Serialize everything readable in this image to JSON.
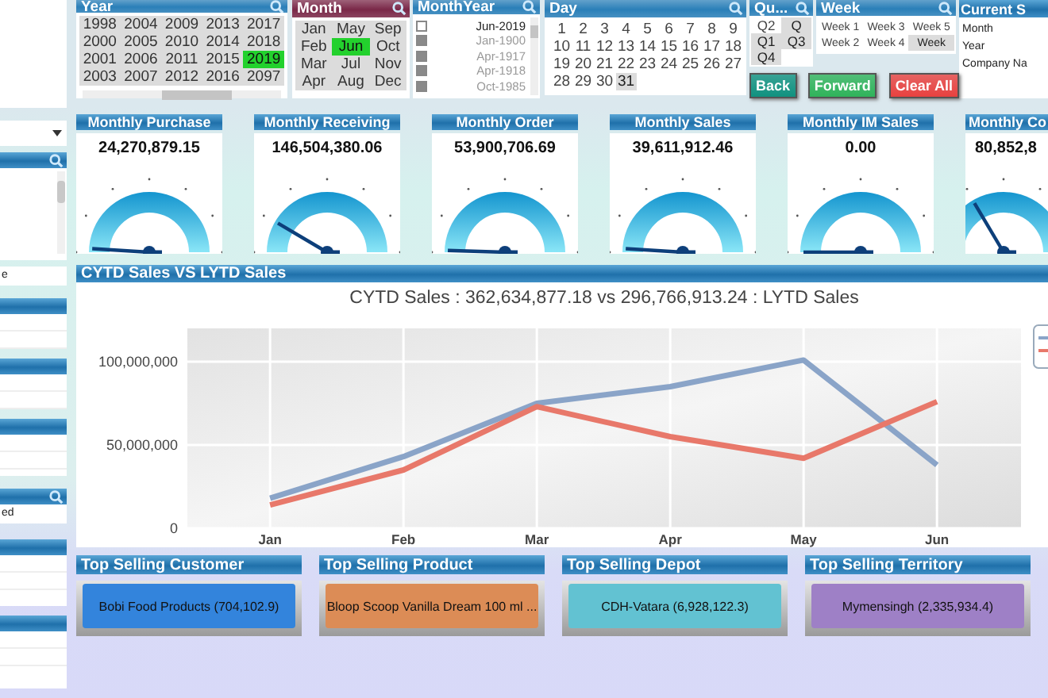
{
  "sidebar": [
    {
      "kind": "dropdown"
    },
    {
      "kind": "listbox",
      "search": true
    },
    {
      "kind": "text",
      "text": "e"
    },
    {
      "kind": "listbox",
      "search": false
    },
    {
      "kind": "listbox",
      "search": false
    },
    {
      "kind": "listbox",
      "search": false
    },
    {
      "kind": "listbox",
      "search": true,
      "text": "ed"
    },
    {
      "kind": "listbox",
      "search": false
    },
    {
      "kind": "listbox",
      "search": false
    }
  ],
  "filters": {
    "year": {
      "title": "Year",
      "color": "#2a7fb8",
      "items": [
        {
          "label": "1998",
          "selected": false
        },
        {
          "label": "2000",
          "selected": false
        },
        {
          "label": "2001",
          "selected": false
        },
        {
          "label": "2003",
          "selected": false
        },
        {
          "label": "2004",
          "selected": false
        },
        {
          "label": "2005",
          "selected": false
        },
        {
          "label": "2006",
          "selected": false
        },
        {
          "label": "2007",
          "selected": false
        },
        {
          "label": "2009",
          "selected": false
        },
        {
          "label": "2010",
          "selected": false
        },
        {
          "label": "2011",
          "selected": false
        },
        {
          "label": "2012",
          "selected": false
        },
        {
          "label": "2013",
          "selected": false
        },
        {
          "label": "2014",
          "selected": false
        },
        {
          "label": "2015",
          "selected": false
        },
        {
          "label": "2016",
          "selected": false
        },
        {
          "label": "2017",
          "selected": false
        },
        {
          "label": "2018",
          "selected": false
        },
        {
          "label": "2019",
          "selected": true
        },
        {
          "label": "2097",
          "selected": false
        }
      ]
    },
    "month": {
      "title": "Month",
      "color": "#7a2848",
      "items": [
        {
          "label": "Jan",
          "selected": false
        },
        {
          "label": "Feb",
          "selected": false
        },
        {
          "label": "Mar",
          "selected": false
        },
        {
          "label": "Apr",
          "selected": false
        },
        {
          "label": "May",
          "selected": false
        },
        {
          "label": "Jun",
          "selected": true
        },
        {
          "label": "Jul",
          "selected": false
        },
        {
          "label": "Aug",
          "selected": false
        },
        {
          "label": "Sep",
          "selected": false
        },
        {
          "label": "Oct",
          "selected": false
        },
        {
          "label": "Nov",
          "selected": false
        },
        {
          "label": "Dec",
          "selected": false
        }
      ]
    },
    "month_year": {
      "title": "MonthYear",
      "color": "#2a7fb8",
      "items": [
        {
          "label": "Jun-2019",
          "excluded": false
        },
        {
          "label": "Jan-1900",
          "excluded": true
        },
        {
          "label": "Apr-1917",
          "excluded": true
        },
        {
          "label": "Apr-1918",
          "excluded": true
        },
        {
          "label": "Oct-1985",
          "excluded": true
        }
      ]
    },
    "day": {
      "title": "Day",
      "color": "#2a7fb8",
      "items": [
        {
          "label": "1",
          "excluded": false
        },
        {
          "label": "2",
          "excluded": false
        },
        {
          "label": "3",
          "excluded": false
        },
        {
          "label": "4",
          "excluded": false
        },
        {
          "label": "5",
          "excluded": false
        },
        {
          "label": "6",
          "excluded": false
        },
        {
          "label": "7",
          "excluded": false
        },
        {
          "label": "8",
          "excluded": false
        },
        {
          "label": "9",
          "excluded": false
        },
        {
          "label": "10",
          "excluded": false
        },
        {
          "label": "11",
          "excluded": false
        },
        {
          "label": "12",
          "excluded": false
        },
        {
          "label": "13",
          "excluded": false
        },
        {
          "label": "14",
          "excluded": false
        },
        {
          "label": "15",
          "excluded": false
        },
        {
          "label": "16",
          "excluded": false
        },
        {
          "label": "17",
          "excluded": false
        },
        {
          "label": "18",
          "excluded": false
        },
        {
          "label": "19",
          "excluded": false
        },
        {
          "label": "20",
          "excluded": false
        },
        {
          "label": "21",
          "excluded": false
        },
        {
          "label": "22",
          "excluded": false
        },
        {
          "label": "23",
          "excluded": false
        },
        {
          "label": "24",
          "excluded": false
        },
        {
          "label": "25",
          "excluded": false
        },
        {
          "label": "26",
          "excluded": false
        },
        {
          "label": "27",
          "excluded": false
        },
        {
          "label": "28",
          "excluded": false
        },
        {
          "label": "29",
          "excluded": false
        },
        {
          "label": "30",
          "excluded": false
        },
        {
          "label": "31",
          "excluded": true
        }
      ]
    },
    "quarter": {
      "title": "Qu...",
      "color": "#2a7fb8",
      "items": [
        {
          "label": "Q2",
          "excluded": false
        },
        {
          "label": "Q",
          "excluded": true
        },
        {
          "label": "Q1",
          "excluded": true
        },
        {
          "label": "Q3",
          "excluded": true
        },
        {
          "label": "Q4",
          "excluded": true
        }
      ]
    },
    "week": {
      "title": "Week",
      "color": "#2a7fb8",
      "items": [
        {
          "label": "Week 1",
          "excluded": false
        },
        {
          "label": "Week 3",
          "excluded": false
        },
        {
          "label": "Week 5",
          "excluded": false
        },
        {
          "label": "Week 2",
          "excluded": false
        },
        {
          "label": "Week 4",
          "excluded": false
        },
        {
          "label": "Week",
          "excluded": true
        }
      ]
    },
    "buttons": [
      {
        "label": "Back",
        "kind": "back"
      },
      {
        "label": "Forward",
        "kind": "forward"
      },
      {
        "label": "Clear All",
        "kind": "clear"
      }
    ],
    "current_selections": {
      "title": "Current S",
      "rows": [
        "Month",
        "Year",
        "Company Na"
      ]
    }
  },
  "gauges": [
    {
      "title": "Monthly Purchase",
      "value": "24,270,879.15"
    },
    {
      "title": "Monthly Receiving",
      "value": "146,504,380.06"
    },
    {
      "title": "Monthly Order",
      "value": "53,900,706.69"
    },
    {
      "title": "Monthly Sales",
      "value": "39,611,912.46"
    },
    {
      "title": "Monthly IM Sales",
      "value": "0.00"
    },
    {
      "title": "Monthly Co",
      "value": "80,852,8"
    }
  ],
  "sales_chart": {
    "caption": "CYTD Sales VS LYTD Sales",
    "chart_data": {
      "type": "line",
      "grid": true,
      "title": "CYTD Sales : 362,634,877.18 vs 296,766,913.24 : LYTD Sales",
      "categories": [
        "Jan",
        "Feb",
        "Mar",
        "Apr",
        "May",
        "Jun"
      ],
      "ylim": [
        0,
        120000000
      ],
      "yticks": [
        {
          "value": 0,
          "label": "0"
        },
        {
          "value": 50000000,
          "label": "50,000,000"
        },
        {
          "value": 100000000,
          "label": "100,000,000"
        }
      ],
      "series": [
        {
          "color": "#8aa4c8",
          "values": [
            18000000,
            43000000,
            75000000,
            85000000,
            101000000,
            38000000
          ]
        },
        {
          "color": "#e8786a",
          "values": [
            14000000,
            35000000,
            73000000,
            55000000,
            42000000,
            76000000
          ]
        }
      ]
    }
  },
  "top_selling": [
    {
      "title": "Top Selling Customer",
      "value": "Bobi Food Products (704,102.9)",
      "color": "#3384dc"
    },
    {
      "title": "Top Selling Product",
      "value": "Bloop Scoop Vanilla Dream 100 ml ...",
      "color": "#dc8c56"
    },
    {
      "title": "Top Selling Depot",
      "value": "CDH-Vatara (6,928,122.3)",
      "color": "#62c2d2"
    },
    {
      "title": "Top Selling Territory",
      "value": "Mymensingh (2,335,934.4)",
      "color": "#9e80c6"
    }
  ]
}
